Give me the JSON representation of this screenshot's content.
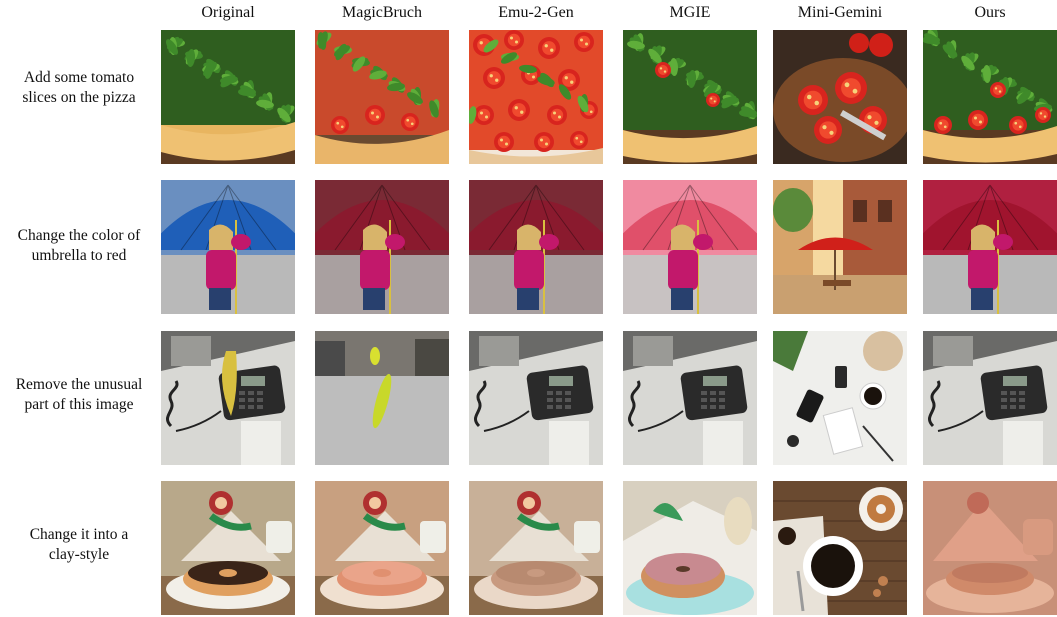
{
  "columns": [
    "Original",
    "MagicBruch",
    "Emu-2-Gen",
    "MGIE",
    "Mini-Gemini",
    "Ours"
  ],
  "rows": [
    {
      "label_lines": [
        "Add some tomato",
        "slices on the pizza"
      ],
      "cells": [
        "pizza-original",
        "pizza-magicbrush",
        "pizza-emu",
        "pizza-mgie",
        "tomato-board",
        "pizza-tomato"
      ]
    },
    {
      "label_lines": [
        "Change the color of",
        "umbrella to red"
      ],
      "cells": [
        "umbrella-blue",
        "umbrella-red-dark",
        "umbrella-red-dark",
        "umbrella-pink",
        "street-red-umbrella",
        "umbrella-red"
      ]
    },
    {
      "label_lines": [
        "Remove the unusual",
        "part of this image"
      ],
      "cells": [
        "phone-banana",
        "street-blur",
        "phone-only",
        "phone-only",
        "desk-topdown",
        "phone-only"
      ]
    },
    {
      "label_lines": [
        "Change it into a",
        "clay-style"
      ],
      "cells": [
        "donut-chocolate",
        "donut-clay",
        "plate-clay",
        "donut-pink",
        "coffee-topdown",
        "clay-scene"
      ]
    }
  ]
}
